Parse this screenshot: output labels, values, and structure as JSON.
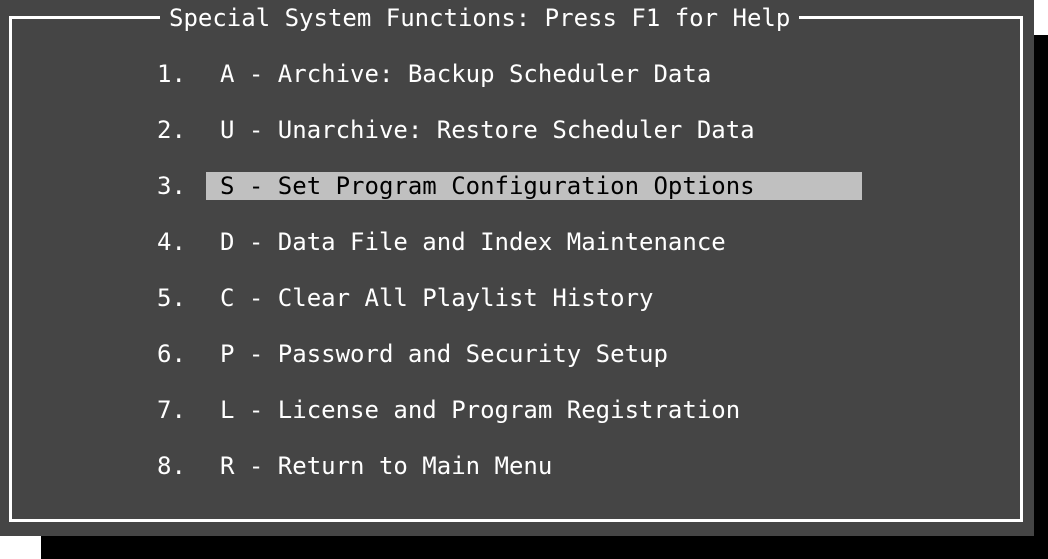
{
  "dialog": {
    "title": "Special System Functions: Press F1 for Help"
  },
  "menu": {
    "items": [
      {
        "number": "1.",
        "label": "A - Archive: Backup Scheduler Data",
        "selected": false
      },
      {
        "number": "2.",
        "label": "U - Unarchive: Restore Scheduler Data",
        "selected": false
      },
      {
        "number": "3.",
        "label": "S - Set Program Configuration Options",
        "selected": true
      },
      {
        "number": "4.",
        "label": "D - Data File and Index Maintenance",
        "selected": false
      },
      {
        "number": "5.",
        "label": "C - Clear All Playlist History",
        "selected": false
      },
      {
        "number": "6.",
        "label": "P - Password and Security Setup",
        "selected": false
      },
      {
        "number": "7.",
        "label": "L - License and Program Registration",
        "selected": false
      },
      {
        "number": "8.",
        "label": "R - Return to Main Menu",
        "selected": false
      }
    ]
  },
  "colors": {
    "background": "#454545",
    "text": "#ffffff",
    "highlight": "#c0c0c0",
    "highlight_text": "#000000",
    "shadow": "#000000"
  }
}
